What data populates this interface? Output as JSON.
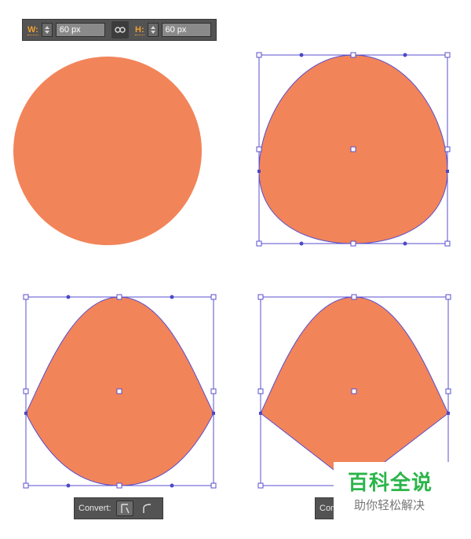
{
  "toolbar": {
    "width_label": "W:",
    "width_value": "60 px",
    "height_label": "H:",
    "height_value": "60 px",
    "link_icon": "link-icon"
  },
  "convert_bars": [
    {
      "label": "Convert:"
    },
    {
      "label": "Conv"
    }
  ],
  "watermark": {
    "title": "百科全说",
    "subtitle": "助你轻松解决"
  },
  "colors": {
    "shape_fill": "#F2845A",
    "path_stroke": "#5A4FCF",
    "handle": "#4B48C8",
    "toolbar_bg": "#535353",
    "accent": "#F0A030",
    "watermark_green": "#2BB54A"
  }
}
